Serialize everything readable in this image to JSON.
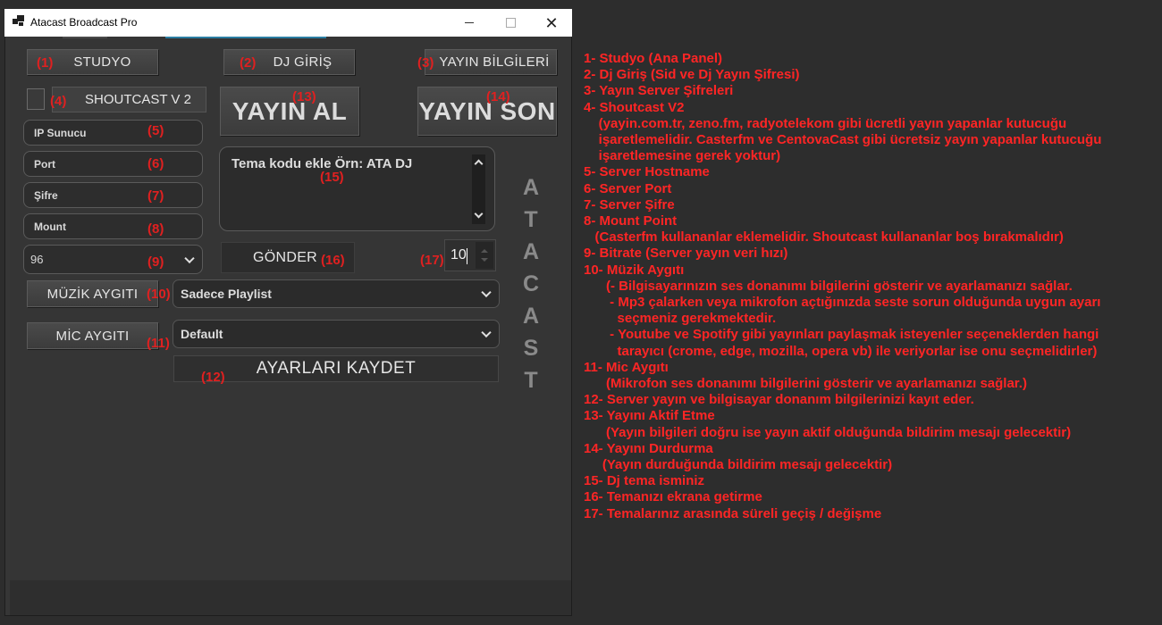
{
  "window": {
    "title": "Atacast Broadcast Pro"
  },
  "buttons": {
    "studio": "STUDYO",
    "dj_login": "DJ GİRİŞ",
    "stream_info": "YAYIN BİLGİLERİ",
    "shoutcast_v2": "SHOUTCAST V 2",
    "go_live": "YAYIN AL",
    "end_stream": "YAYIN SON",
    "send": "GÖNDER",
    "music_device": "MÜZİK AYGITI",
    "mic_device": "MİC AYGITI",
    "save_settings": "AYARLARI KAYDET"
  },
  "fields": {
    "ip": "IP Sunucu",
    "port": "Port",
    "password": "Şifre",
    "mount": "Mount",
    "bitrate": "96",
    "theme_text": "Tema kodu ekle Örn: ATA DJ",
    "interval": "10"
  },
  "dropdowns": {
    "music_device": "Sadece Playlist",
    "mic_device": "Default"
  },
  "markers": {
    "m1": "(1)",
    "m2": "(2)",
    "m3": "(3)",
    "m4": "(4)",
    "m5": "(5)",
    "m6": "(6)",
    "m7": "(7)",
    "m8": "(8)",
    "m9": "(9)",
    "m10": "(10)",
    "m11": "(11)",
    "m12": "(12)",
    "m13": "(13)",
    "m14": "(14)",
    "m15": "(15)",
    "m16": "(16)",
    "m17": "(17)"
  },
  "vertical_brand": [
    "A",
    "T",
    "A",
    "C",
    "A",
    "S",
    "T"
  ],
  "notes": [
    "1- Studyo (Ana Panel)",
    "2- Dj Giriş (Sid ve Dj Yayın Şifresi)",
    "3- Yayın Server Şifreleri",
    "4- Shoutcast V2",
    "    (yayin.com.tr, zeno.fm, radyotelekom gibi ücretli yayın yapanlar kutucuğu",
    "    işaretlemelidir. Casterfm ve CentovaCast gibi ücretsiz yayın yapanlar kutucuğu",
    "    işaretlemesine gerek yoktur)",
    "5- Server Hostname",
    "6- Server Port",
    "7- Server Şifre",
    "8- Mount Point",
    "   (Casterfm kullananlar eklemelidir. Shoutcast kullananlar boş bırakmalıdır)",
    "9- Bitrate (Server yayın veri hızı)",
    "10- Müzik Aygıtı",
    "      (- Bilgisayarınızın ses donanımı bilgilerini gösterir ve ayarlamanızı sağlar.",
    "       - Mp3 çalarken veya mikrofon açtığınızda seste sorun olduğunda uygun ayarı",
    "         seçmeniz gerekmektedir.",
    "       - Youtube ve Spotify gibi yayınları paylaşmak isteyenler seçeneklerden hangi",
    "         tarayıcı (crome, edge, mozilla, opera vb) ile veriyorlar ise onu seçmelidirler)",
    "11- Mic Aygıtı",
    "      (Mikrofon ses donanımı bilgilerini gösterir ve ayarlamanızı sağlar.)",
    "12- Server yayın ve bilgisayar donanım bilgilerinizi kayıt eder.",
    "13- Yayını Aktif Etme",
    "      (Yayın bilgileri doğru ise yayın aktif olduğunda bildirim mesajı gelecektir)",
    "14- Yayını Durdurma",
    "     (Yayın durduğunda bildirim mesajı gelecektir)",
    "15- Dj tema isminiz",
    "16- Temanızı ekrana getirme",
    "17- Temalarınız arasında süreli geçiş / değişme"
  ]
}
